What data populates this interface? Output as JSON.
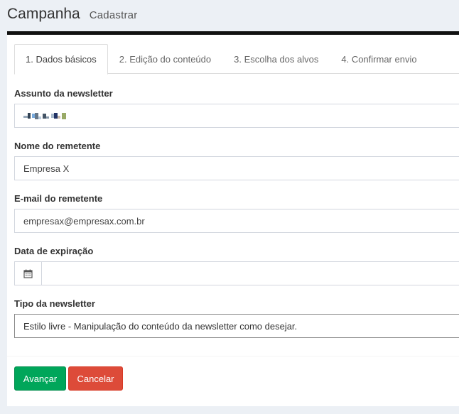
{
  "header": {
    "title": "Campanha",
    "subtitle": "Cadastrar"
  },
  "tabs": [
    {
      "label": "1. Dados básicos",
      "active": true
    },
    {
      "label": "2. Edição do conteúdo",
      "active": false
    },
    {
      "label": "3. Escolha dos alvos",
      "active": false
    },
    {
      "label": "4. Confirmar envio",
      "active": false
    }
  ],
  "form": {
    "subject": {
      "label": "Assunto da newsletter"
    },
    "sender_name": {
      "label": "Nome do remetente",
      "value": "Empresa X"
    },
    "sender_email": {
      "label": "E-mail do remetente",
      "value": "empresax@empresax.com.br"
    },
    "expiration": {
      "label": "Data de expiração",
      "icon": "calendar-icon"
    },
    "type": {
      "label": "Tipo da newsletter",
      "value": "Estilo livre - Manipulação do conteúdo da newsletter como desejar."
    }
  },
  "buttons": {
    "next": "Avançar",
    "cancel": "Cancelar"
  },
  "colors": {
    "primary_green": "#00a65a",
    "danger_red": "#dd4b39"
  }
}
